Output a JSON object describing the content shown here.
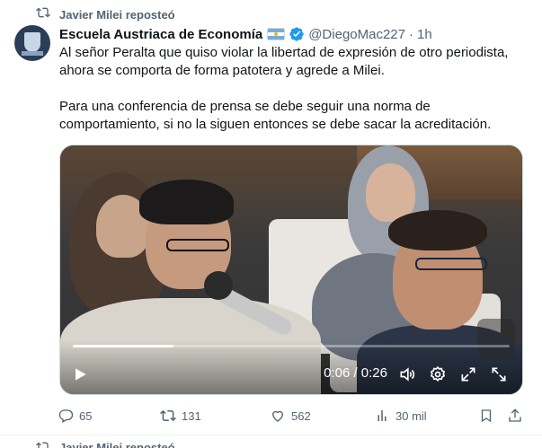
{
  "repost": {
    "label": "Javier Milei reposteó",
    "icon": "repost-icon"
  },
  "tweet": {
    "author_name": "Escuela Austriaca de Economía",
    "flag": "argentina-flag-icon",
    "verified_icon": "verified-badge-icon",
    "verified_color": "#1d9bf0",
    "handle": "@DiegoMac227",
    "separator": "·",
    "time": "1h",
    "paragraph_1": "Al señor Peralta que quiso violar la libertad de expresión de otro periodista, ahora se comporta de forma patotera y agrede a Milei.",
    "paragraph_2": "Para una conferencia de prensa se debe seguir una norma de comportamiento, si no la siguen entonces se debe sacar la acreditación."
  },
  "video": {
    "timecode": "0:06 / 0:26",
    "progress": 0.23,
    "controls": [
      "play-icon",
      "volume-icon",
      "settings-gear-icon",
      "pop-out-icon",
      "fullscreen-icon"
    ]
  },
  "actions": {
    "replies": "65",
    "reposts": "131",
    "likes": "562",
    "views": "30 mil"
  },
  "next_item": {
    "label": "Javier Milei reposteó"
  },
  "colors": {
    "muted": "#536471",
    "text": "#0f1419",
    "accent": "#1d9bf0"
  }
}
